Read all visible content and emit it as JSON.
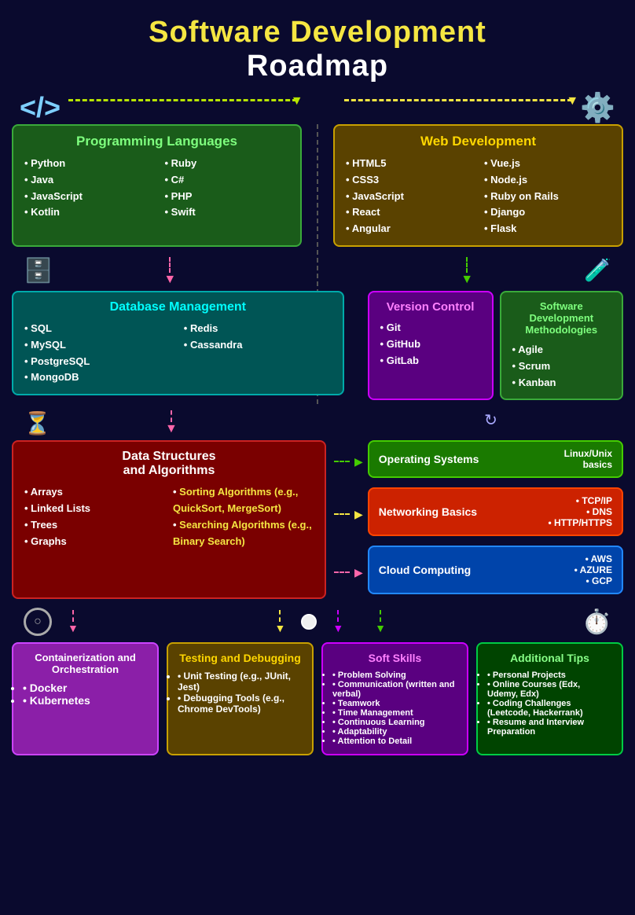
{
  "title": {
    "line1": "Software Development",
    "line2": "Roadmap"
  },
  "sections": {
    "programming_languages": {
      "title": "Programming Languages",
      "col1": [
        "Python",
        "Java",
        "JavaScript",
        "Kotlin"
      ],
      "col2": [
        "Ruby",
        "C#",
        "PHP",
        "Swift"
      ]
    },
    "web_development": {
      "title": "Web Development",
      "col1": [
        "HTML5",
        "CSS3",
        "JavaScript",
        "React",
        "Angular"
      ],
      "col2": [
        "Vue.js",
        "Node.js",
        "Ruby on Rails",
        "Django",
        "Flask"
      ]
    },
    "database_management": {
      "title": "Database Management",
      "col1": [
        "SQL",
        "MySQL",
        "PostgreSQL",
        "MongoDB"
      ],
      "col2": [
        "Redis",
        "Cassandra"
      ]
    },
    "version_control": {
      "title": "Version Control",
      "items": [
        "Git",
        "GitHub",
        "GitLab"
      ]
    },
    "sdm": {
      "title": "Software Development Methodologies",
      "items": [
        "Agile",
        "Scrum",
        "Kanban"
      ]
    },
    "dsa": {
      "title": "Data Structures and Algorithms",
      "col1": [
        "Arrays",
        "Linked Lists",
        "Trees",
        "Graphs"
      ],
      "col2_highlight": [
        "Sorting Algorithms (e.g., QuickSort, MergeSort)",
        "Searching Algorithms (e.g., Binary Search)"
      ]
    },
    "operating_systems": {
      "title": "Operating Systems",
      "note": "Linux/Unix basics"
    },
    "networking": {
      "title": "Networking Basics",
      "note": "TCP/IP\nDNS\nHTTP/HTTPS"
    },
    "cloud": {
      "title": "Cloud Computing",
      "note": "AWS\nAZURE\nGCP"
    },
    "containerization": {
      "title": "Containerization and Orchestration",
      "items": [
        "Docker",
        "Kubernetes"
      ]
    },
    "testing": {
      "title": "Testing and Debugging",
      "items": [
        "Unit Testing (e.g., JUnit, Jest)",
        "Debugging Tools (e.g., Chrome DevTools)"
      ]
    },
    "soft_skills": {
      "title": "Soft Skills",
      "items": [
        "Problem Solving",
        "Communication (written and verbal)",
        "Teamwork",
        "Time Management",
        "Continuous Learning",
        "Adaptability",
        "Attention to Detail"
      ]
    },
    "additional_tips": {
      "title": "Additional Tips",
      "items": [
        "Personal Projects",
        "Online Courses (Edx, Udemy, Edx)",
        "Coding Challenges (Leetcode, Hackerrank)",
        "Resume and Interview Preparation"
      ]
    }
  }
}
